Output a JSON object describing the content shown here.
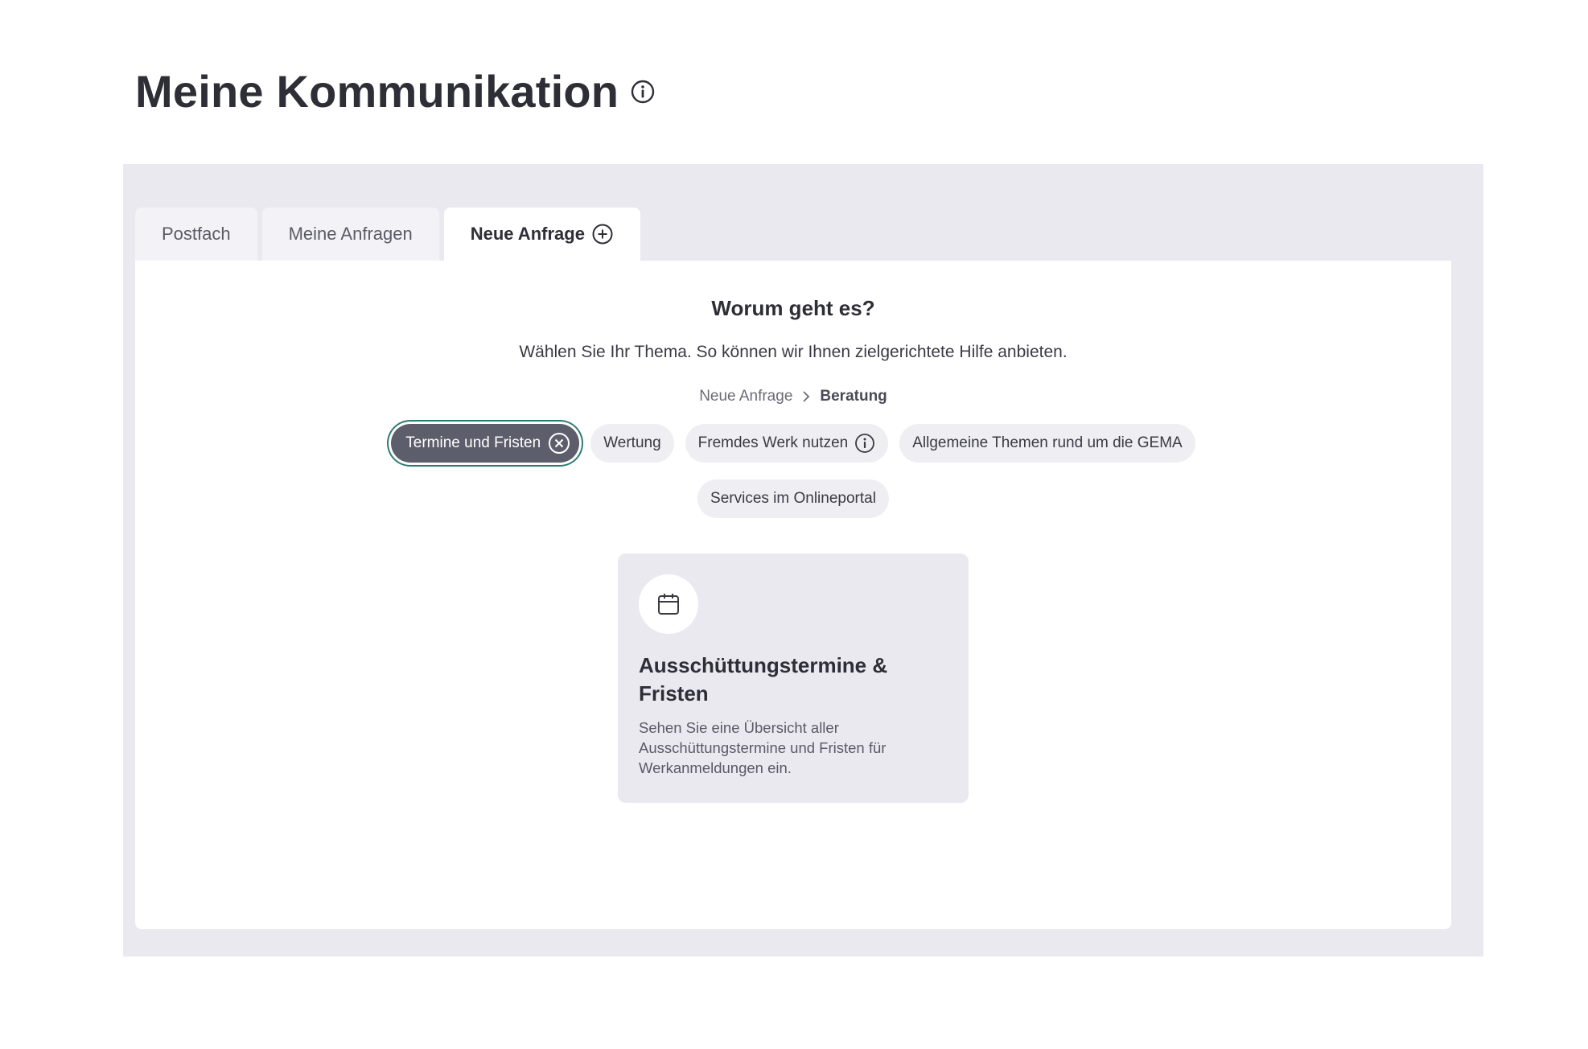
{
  "page": {
    "title": "Meine Kommunikation",
    "title_icon": "info-icon"
  },
  "tabs": [
    {
      "label": "Postfach",
      "active": false
    },
    {
      "label": "Meine Anfragen",
      "active": false
    },
    {
      "label": "Neue Anfrage",
      "active": true,
      "icon": "plus-circle-icon"
    }
  ],
  "main": {
    "heading": "Worum geht es?",
    "subtext": "Wählen Sie Ihr Thema. So können wir Ihnen zielgerichtete Hilfe anbieten.",
    "breadcrumb": {
      "parent": "Neue Anfrage",
      "separator_icon": "chevron-right-icon",
      "current": "Beratung"
    },
    "chips": [
      {
        "label": "Termine und Fristen",
        "selected": true,
        "icon": "close-circle-icon"
      },
      {
        "label": "Wertung",
        "selected": false
      },
      {
        "label": "Fremdes Werk nutzen",
        "selected": false,
        "icon": "info-icon"
      },
      {
        "label": "Allgemeine Themen rund um die GEMA",
        "selected": false
      },
      {
        "label": "Services im Onlineportal",
        "selected": false
      }
    ],
    "topic_card": {
      "icon": "calendar-icon",
      "title": "Ausschüttungstermine & Fristen",
      "description": "Sehen Sie eine Übersicht aller Ausschüttungstermine und Fristen für Werkanmeldungen ein."
    }
  },
  "colors": {
    "panel_bg": "#ebe9f0",
    "selected_chip_bg": "#5d5e6b",
    "focus_ring": "#2c7b72",
    "text_primary": "#2e2e36"
  }
}
